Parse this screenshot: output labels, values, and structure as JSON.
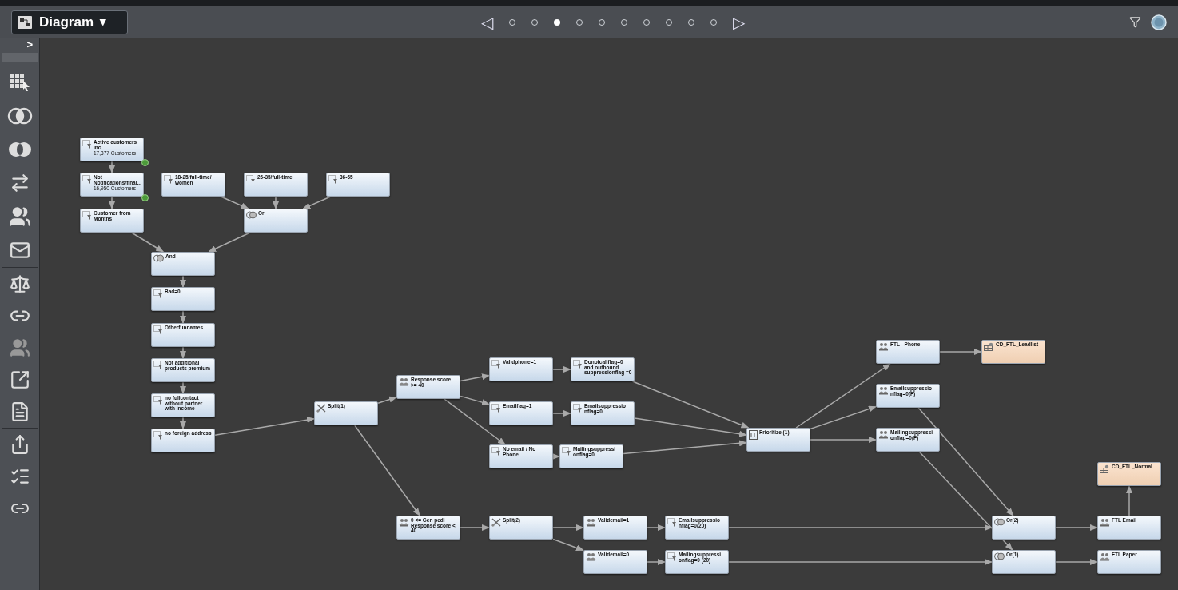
{
  "toolbar": {
    "view_menu": {
      "label": "Diagram",
      "caret": "▾"
    },
    "pager": {
      "prev": "◁",
      "next": "▷",
      "pages": [
        {
          "selected": false
        },
        {
          "selected": false
        },
        {
          "selected": true
        },
        {
          "selected": false
        },
        {
          "selected": false
        },
        {
          "selected": false
        },
        {
          "selected": false
        },
        {
          "selected": false
        },
        {
          "selected": false
        },
        {
          "selected": false
        }
      ]
    }
  },
  "sidebar": {
    "toggle": ">"
  },
  "diagram": {
    "nodes": [
      {
        "kind": "filter",
        "label": "Active customers inc...",
        "sub": "17,377 Customers",
        "validated": true
      },
      {
        "kind": "filter",
        "label": "Not Notifications/final...",
        "sub": "16,950 Customers",
        "validated": true
      },
      {
        "kind": "filter",
        "label": "18-25/full-time/ women",
        "validated": false
      },
      {
        "kind": "filter",
        "label": "26-35/full-time",
        "validated": false
      },
      {
        "kind": "filter",
        "label": "36-65",
        "validated": false
      },
      {
        "kind": "filter",
        "label": "Customer from Months",
        "validated": false
      },
      {
        "kind": "merge",
        "label": "Or",
        "validated": false
      },
      {
        "kind": "merge",
        "label": "And",
        "validated": false
      },
      {
        "kind": "filter",
        "label": "Bad=0",
        "validated": false
      },
      {
        "kind": "filter",
        "label": "Otherfunnames",
        "validated": false
      },
      {
        "kind": "filter",
        "label": "Not additional products premium",
        "validated": false
      },
      {
        "kind": "filter",
        "label": "no fullcontact without partner with income",
        "validated": false
      },
      {
        "kind": "filter",
        "label": "no foreign address",
        "validated": false
      },
      {
        "kind": "split",
        "label": "Split(1)",
        "validated": false
      },
      {
        "kind": "segment",
        "label": "Response score >= 40",
        "validated": false
      },
      {
        "kind": "filter",
        "label": "Validphone=1",
        "validated": false
      },
      {
        "kind": "filter",
        "label": "Donotcallflag=0 and outbound suppressionflag =0",
        "validated": false
      },
      {
        "kind": "filter",
        "label": "Emailflag=1",
        "validated": false
      },
      {
        "kind": "filter",
        "label": "Emailsuppressio nflag=0",
        "validated": false
      },
      {
        "kind": "filter",
        "label": "No email / No Phone",
        "validated": false
      },
      {
        "kind": "filter",
        "label": "Mailingsuppressi onflag=0",
        "validated": false
      },
      {
        "kind": "prioritize",
        "label": "Prioritize (1)",
        "validated": false
      },
      {
        "kind": "segment",
        "label": "FTL - Phone",
        "validated": false
      },
      {
        "kind": "output",
        "label": "CD_FTL_Leadlist",
        "validated": false
      },
      {
        "kind": "segment",
        "label": "Emailsuppressio nflag=0(F)",
        "validated": false
      },
      {
        "kind": "segment",
        "label": "Mailingsuppressi onflag=0(F)",
        "validated": false
      },
      {
        "kind": "segment",
        "label": "0 <= Gen pedi Response score < 40",
        "validated": false
      },
      {
        "kind": "split",
        "label": "Split(2)",
        "validated": false
      },
      {
        "kind": "segment",
        "label": "Validemail=1",
        "validated": false
      },
      {
        "kind": "segment",
        "label": "Validemail=0",
        "validated": false
      },
      {
        "kind": "filter",
        "label": "Emailsuppressio nflag=0(20)",
        "validated": false
      },
      {
        "kind": "filter",
        "label": "Mailingsuppressi onflag=0 (20)",
        "validated": false
      },
      {
        "kind": "merge",
        "label": "Or(2)",
        "validated": false
      },
      {
        "kind": "merge",
        "label": "Or(1)",
        "validated": false
      },
      {
        "kind": "output",
        "label": "CD_FTL_Normal",
        "validated": false
      },
      {
        "kind": "segment",
        "label": "FTL Email",
        "validated": false
      },
      {
        "kind": "segment",
        "label": "FTL Paper",
        "validated": false
      }
    ]
  }
}
